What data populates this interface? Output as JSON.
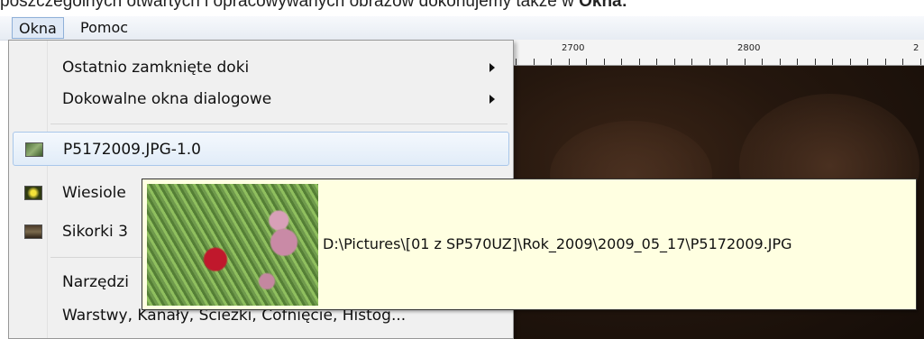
{
  "caption": {
    "text": "poszczególnych otwartych i opracowywanych obrazów dokonujemy także w ",
    "bold": "Okna:"
  },
  "menubar": {
    "items": [
      {
        "label": "Okna",
        "active": true
      },
      {
        "label": "Pomoc",
        "active": false
      }
    ]
  },
  "ruler": {
    "labels": [
      "2700",
      "2800",
      "2"
    ]
  },
  "menu": {
    "items": [
      {
        "label": "Ostatnio zamknięte doki",
        "submenu": true
      },
      {
        "label": "Dokowalne okna dialogowe",
        "submenu": true
      },
      {
        "label": "P5172009.JPG-1.0",
        "highlighted": true,
        "icon": "image-thumbnail-icon"
      },
      {
        "label": "Wiesiole",
        "icon": "image-thumbnail-icon"
      },
      {
        "label": "Sikorki 3",
        "icon": "image-thumbnail-icon"
      },
      {
        "label": "Narzędzi"
      },
      {
        "label": "Warstwy, Kanały, Ścieżki, Cofnięcie, Histog..."
      }
    ]
  },
  "tooltip": {
    "path": "D:\\Pictures\\[01 z SP570UZ]\\Rok_2009\\2009_05_17\\P5172009.JPG"
  }
}
